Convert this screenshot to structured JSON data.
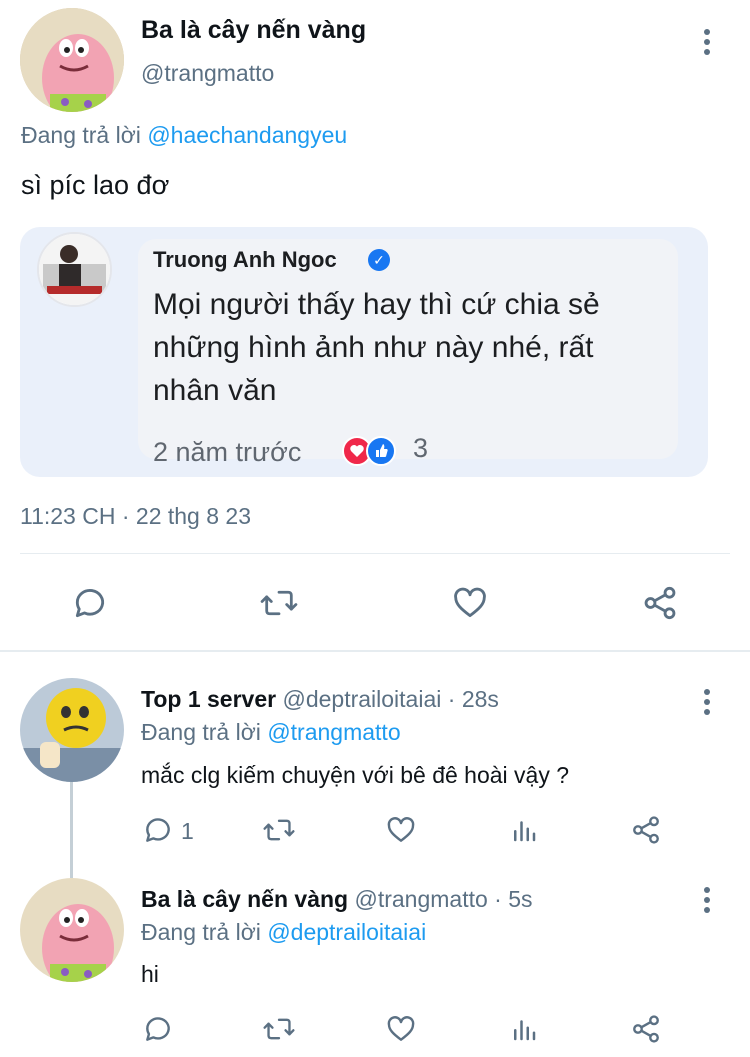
{
  "main_tweet": {
    "display_name": "Ba là cây nến vàng",
    "handle": "@trangmatto",
    "replying_prefix": "Đang trả lời ",
    "replying_to": "@haechandangyeu",
    "text": "sì píc lao đơ",
    "timestamp": "11:23 CH · 22 thg 8 23"
  },
  "embedded_post": {
    "author": "Truong Anh Ngoc",
    "verified_icon": "verified-badge-icon",
    "text": "Mọi người thấy hay thì cứ chia sẻ những hình ảnh như này nhé, rất nhân văn",
    "time": "2 năm trước",
    "reaction_count": "3"
  },
  "replies": [
    {
      "display_name": "Top 1 server",
      "handle": "@deptrailoitaiai",
      "age": "· 28s",
      "replying_prefix": "Đang trả lời ",
      "replying_to": "@trangmatto",
      "text": "mắc clg kiếm chuyện với bê đê hoài vậy ?",
      "reply_count": "1"
    },
    {
      "display_name": "Ba là cây nến vàng",
      "handle": "@trangmatto",
      "age": "· 5s",
      "replying_prefix": "Đang trả lời ",
      "replying_to": "@deptrailoitaiai",
      "text": "hi",
      "reply_count": ""
    }
  ],
  "colors": {
    "link": "#1d9bf0",
    "secondary_text": "#5b7083",
    "divider": "#e6ecf0"
  }
}
